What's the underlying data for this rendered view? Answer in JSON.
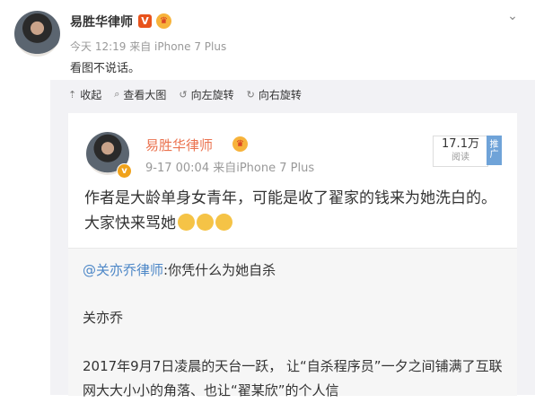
{
  "post": {
    "author": "易胜华律师",
    "vip_badge": "V",
    "time_source": "今天 12:19 来自 iPhone 7 Plus",
    "text": "看图不说话。"
  },
  "toolbar": {
    "collapse": "收起",
    "view_large": "查看大图",
    "rotate_left": "向左旋转",
    "rotate_right": "向右旋转"
  },
  "repost": {
    "author": "易胜华律师",
    "time_source": "9-17 00:04  来自iPhone 7 Plus",
    "read_count": "17.1万",
    "read_label": "阅读",
    "promote": "推广",
    "text": "作者是大龄单身女青年，可能是收了翟家的钱来为她洗白的。大家快来骂她"
  },
  "quote": {
    "mention": "@关亦乔律师",
    "line1_rest": ":你凭什么为她自杀",
    "line2": "关亦乔",
    "line3": "2017年9月7日凌晨的天台一跃， 让“自杀程序员”一夕之间铺满了互联网大大小小的角落、也让“翟某欣”的个人信"
  },
  "colors": {
    "accent": "#eb7350",
    "link": "#4d87c7",
    "badge": "#e8531c"
  }
}
